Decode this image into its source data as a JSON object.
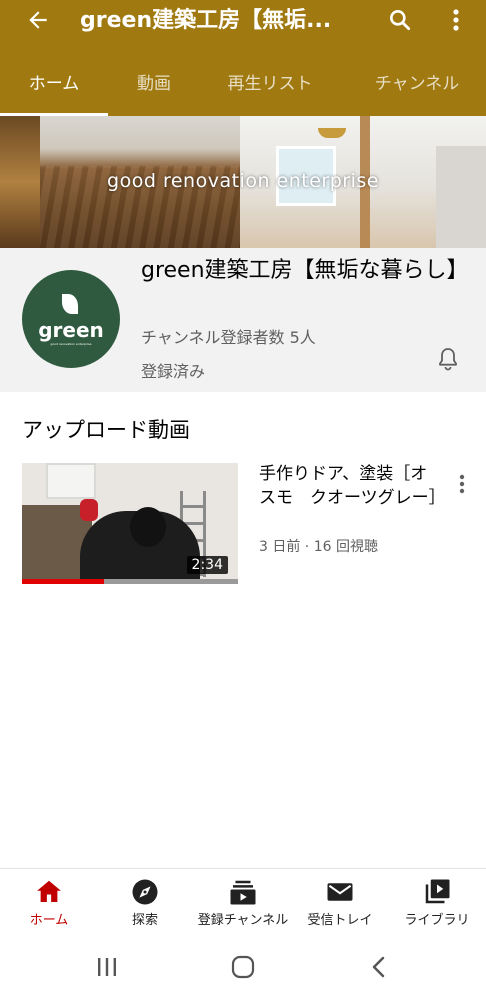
{
  "header": {
    "title": "green建築工房【無垢...",
    "bg_color": "#a07a10"
  },
  "tabs": [
    {
      "label": "ホーム",
      "active": true
    },
    {
      "label": "動画",
      "active": false
    },
    {
      "label": "再生リスト",
      "active": false
    },
    {
      "label": "チャンネル",
      "active": false
    }
  ],
  "banner": {
    "text": "good renovation enterprise"
  },
  "channel": {
    "name": "green建築工房【無垢な暮らし】",
    "avatar_text": "green",
    "avatar_subtext": "good renovation enterprise",
    "subscribers": "チャンネル登録者数 5人",
    "subscribed_label": "登録済み"
  },
  "uploads": {
    "section_title": "アップロード動画",
    "videos": [
      {
        "title": "手作りドア、塗装［オスモ　クオーツグレー］",
        "meta": "3 日前 · 16 回視聴",
        "duration": "2:34",
        "watched_fraction": 0.38
      }
    ]
  },
  "bottom_nav": [
    {
      "label": "ホーム",
      "icon": "home-icon",
      "active": true
    },
    {
      "label": "探索",
      "icon": "explore-icon",
      "active": false
    },
    {
      "label": "登録チャンネル",
      "icon": "subscriptions-icon",
      "active": false
    },
    {
      "label": "受信トレイ",
      "icon": "inbox-icon",
      "active": false
    },
    {
      "label": "ライブラリ",
      "icon": "library-icon",
      "active": false
    }
  ],
  "colors": {
    "accent": "#c00000",
    "progress": "#e00000",
    "avatar_bg": "#2f5a40"
  }
}
